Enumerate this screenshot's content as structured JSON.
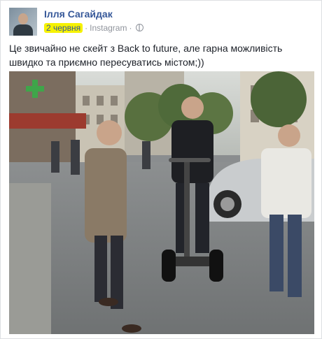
{
  "post": {
    "author": "Ілля Сагайдак",
    "date": "2 червня",
    "separator": "·",
    "source": "Instagram",
    "privacy_icon": "globe-icon",
    "text": "Це звичайно не скейт з Back to future, але гарна можливість швидко та приємно пересуватись містом;))",
    "highlight_color": "#f6f200",
    "link_color": "#365899"
  },
  "media": {
    "type": "video",
    "description_icon": "video-frame"
  }
}
